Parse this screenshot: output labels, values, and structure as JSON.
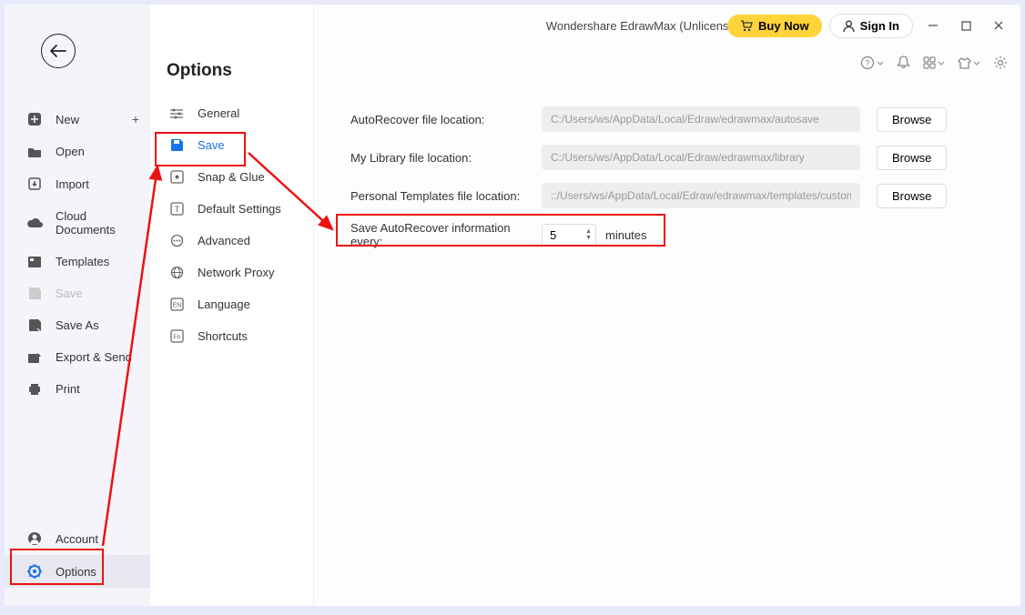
{
  "title": "Wondershare EdrawMax (Unlicensed Version)",
  "buy": "Buy Now",
  "signin": "Sign In",
  "file_menu": {
    "new": "New",
    "open": "Open",
    "import": "Import",
    "cloud": "Cloud Documents",
    "templates": "Templates",
    "save": "Save",
    "saveas": "Save As",
    "export": "Export & Send",
    "print": "Print",
    "account": "Account",
    "options": "Options"
  },
  "options_title": "Options",
  "options": {
    "general": "General",
    "save": "Save",
    "snapglue": "Snap & Glue",
    "default": "Default Settings",
    "advanced": "Advanced",
    "network": "Network Proxy",
    "language": "Language",
    "shortcuts": "Shortcuts"
  },
  "form": {
    "autorecover_label": "AutoRecover file location:",
    "autorecover_path": "C:/Users/ws/AppData/Local/Edraw/edrawmax/autosave",
    "library_label": "My Library file location:",
    "library_path": "C:/Users/ws/AppData/Local/Edraw/edrawmax/library",
    "templates_label": "Personal Templates file location:",
    "templates_path": "::/Users/ws/AppData/Local/Edraw/edrawmax/templates/custom",
    "browse": "Browse",
    "save_every_label": "Save AutoRecover information every:",
    "save_every_value": "5",
    "save_every_unit": "minutes"
  }
}
